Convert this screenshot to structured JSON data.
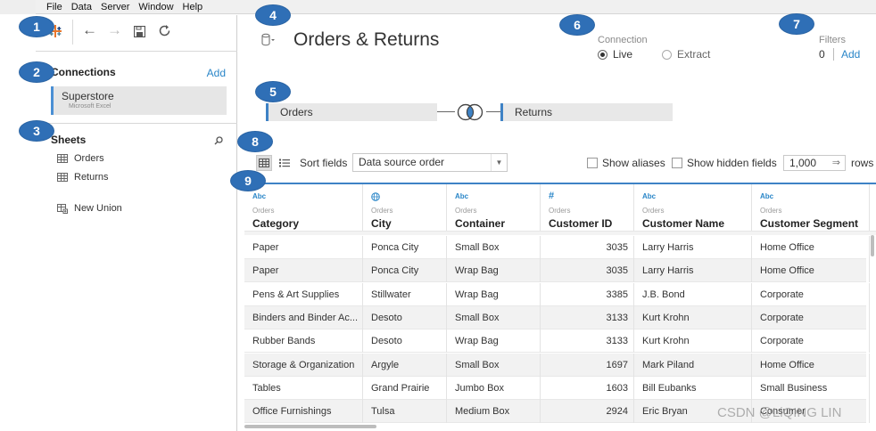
{
  "menu": [
    "File",
    "Data",
    "Server",
    "Window",
    "Help"
  ],
  "callouts": [
    "1",
    "2",
    "3",
    "4",
    "5",
    "6",
    "7",
    "8",
    "9"
  ],
  "connections": {
    "title": "Connections",
    "add_label": "Add",
    "items": [
      {
        "name": "Superstore",
        "type": "Microsoft Excel"
      }
    ]
  },
  "sheets": {
    "title": "Sheets",
    "items": [
      "Orders",
      "Returns"
    ],
    "new_union": "New Union"
  },
  "datasource": {
    "title": "Orders & Returns",
    "connection_label": "Connection",
    "live_label": "Live",
    "extract_label": "Extract",
    "selected": "Live",
    "filters_label": "Filters",
    "filters_count": "0",
    "filters_add": "Add"
  },
  "join": {
    "left_table": "Orders",
    "right_table": "Returns"
  },
  "grid_toolbar": {
    "sort_label": "Sort fields",
    "sort_value": "Data source order",
    "show_aliases": "Show aliases",
    "show_hidden": "Show hidden fields",
    "rows_value": "1,000",
    "rows_label": "rows"
  },
  "grid": {
    "columns": [
      {
        "type": "Abc",
        "source": "Orders",
        "name": "Category"
      },
      {
        "type": "globe",
        "source": "Orders",
        "name": "City"
      },
      {
        "type": "Abc",
        "source": "Orders",
        "name": "Container"
      },
      {
        "type": "#",
        "source": "Orders",
        "name": "Customer ID"
      },
      {
        "type": "Abc",
        "source": "Orders",
        "name": "Customer Name"
      },
      {
        "type": "Abc",
        "source": "Orders",
        "name": "Customer Segment"
      }
    ],
    "rows": [
      [
        "Paper",
        "Ponca City",
        "Small Box",
        "3035",
        "Larry Harris",
        "Home Office"
      ],
      [
        "Paper",
        "Ponca City",
        "Wrap Bag",
        "3035",
        "Larry Harris",
        "Home Office"
      ],
      [
        "Pens & Art Supplies",
        "Stillwater",
        "Wrap Bag",
        "3385",
        "J.B. Bond",
        "Corporate"
      ],
      [
        "Binders and Binder Ac...",
        "Desoto",
        "Small Box",
        "3133",
        "Kurt Krohn",
        "Corporate"
      ],
      [
        "Rubber Bands",
        "Desoto",
        "Wrap Bag",
        "3133",
        "Kurt Krohn",
        "Corporate"
      ],
      [
        "Storage & Organization",
        "Argyle",
        "Small Box",
        "1697",
        "Mark Piland",
        "Home Office"
      ],
      [
        "Tables",
        "Grand Prairie",
        "Jumbo Box",
        "1603",
        "Bill Eubanks",
        "Small Business"
      ],
      [
        "Office Furnishings",
        "Tulsa",
        "Medium Box",
        "2924",
        "Eric Bryan",
        "Consumer"
      ]
    ]
  },
  "watermark": "CSDN @LiQING LIN",
  "colors": {
    "accent": "#3e82c5",
    "callout": "#2f6fb6",
    "link": "#2a86c8"
  }
}
